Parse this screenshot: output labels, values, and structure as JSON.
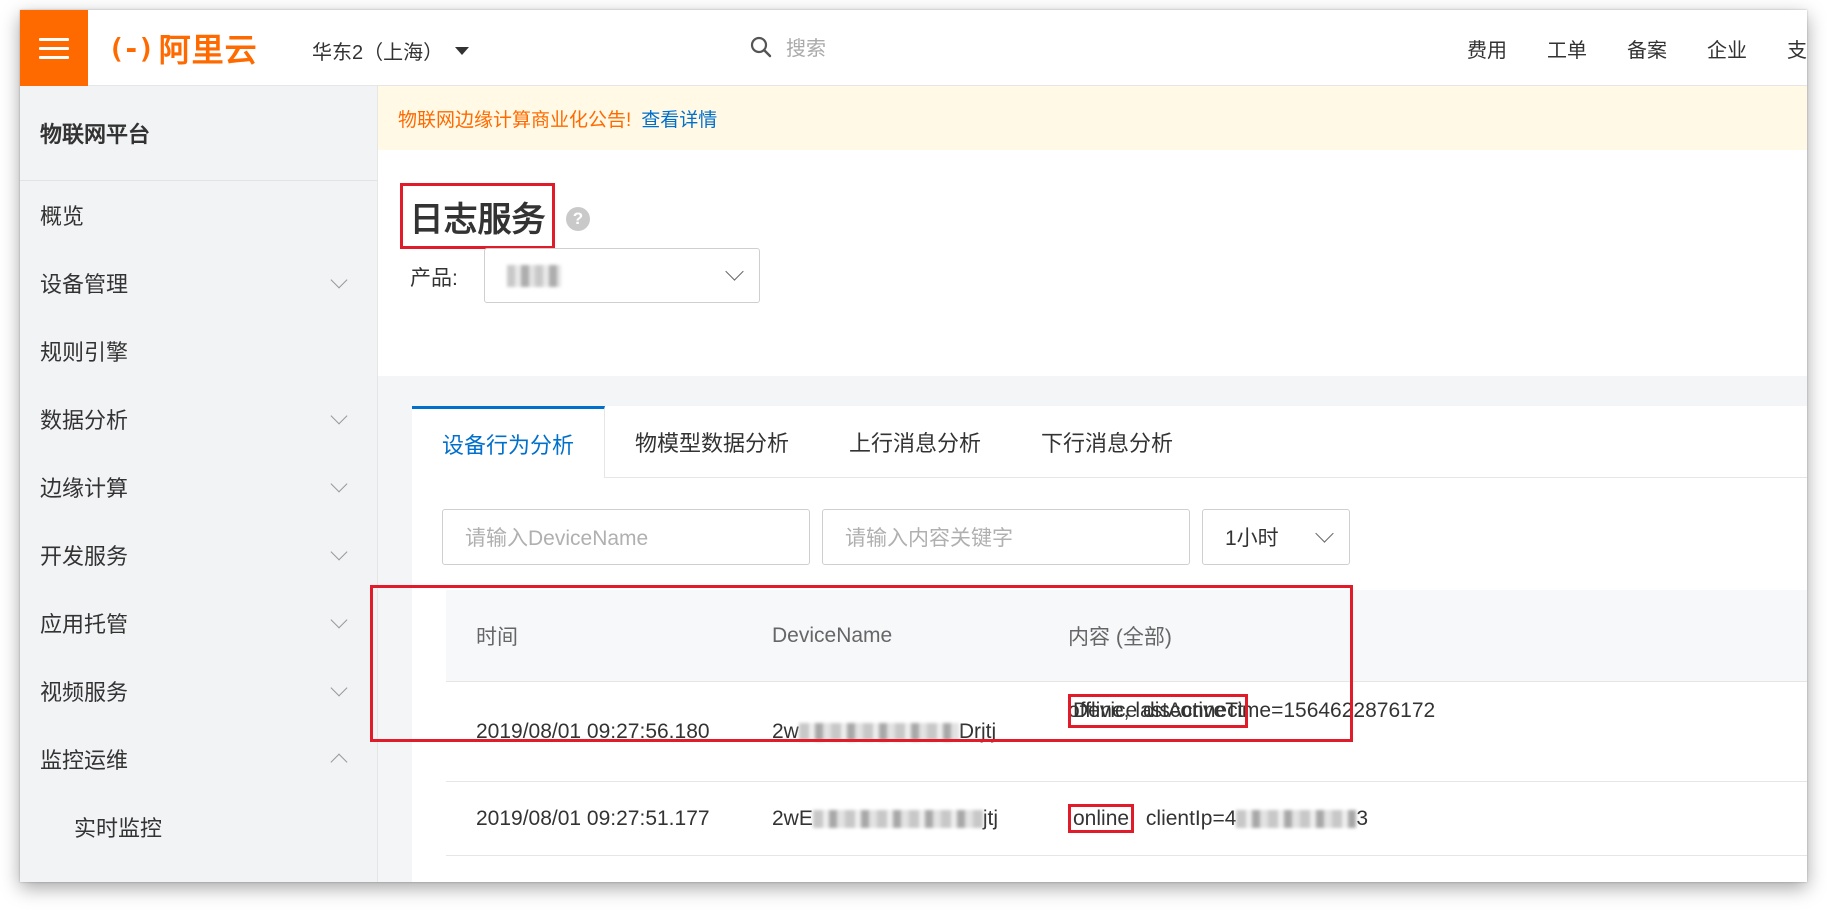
{
  "header": {
    "logo_text": "阿里云",
    "logo_mark": "(-)",
    "region": "华东2（上海）",
    "search_placeholder": "搜索",
    "nav": [
      "费用",
      "工单",
      "备案",
      "企业",
      "支"
    ]
  },
  "sidebar": {
    "title": "物联网平台",
    "items": [
      {
        "label": "概览"
      },
      {
        "label": "设备管理"
      },
      {
        "label": "规则引擎"
      },
      {
        "label": "数据分析"
      },
      {
        "label": "边缘计算"
      },
      {
        "label": "开发服务"
      },
      {
        "label": "应用托管"
      },
      {
        "label": "视频服务"
      },
      {
        "label": "监控运维"
      },
      {
        "label": "实时监控"
      }
    ]
  },
  "notice": {
    "text": "物联网边缘计算商业化公告!",
    "link": "查看详情"
  },
  "page": {
    "title": "日志服务",
    "product_label": "产品:"
  },
  "tabs": [
    "设备行为分析",
    "物模型数据分析",
    "上行消息分析",
    "下行消息分析"
  ],
  "filters": {
    "device_placeholder": "请输入DeviceName",
    "keyword_placeholder": "请输入内容关键字",
    "time_range": "1小时"
  },
  "table": {
    "headers": [
      "时间",
      "DeviceName",
      "内容 (全部)"
    ],
    "rows": [
      {
        "time": "2019/08/01 09:27:56.180",
        "device_prefix": "2w",
        "device_suffix": "Drjtj",
        "content_line1": "offline, lastActiveTime=1564622876172",
        "content_line2": "Device disconnect"
      },
      {
        "time": "2019/08/01 09:27:51.177",
        "device_prefix": "2wE",
        "device_suffix": "jtj",
        "content_status": "online",
        "content_rest_prefix": "clientIp=4",
        "content_rest_suffix": "3"
      }
    ]
  },
  "colors": {
    "brand": "#ff6a00",
    "link": "#0070cc",
    "highlight": "#e01b2a"
  }
}
